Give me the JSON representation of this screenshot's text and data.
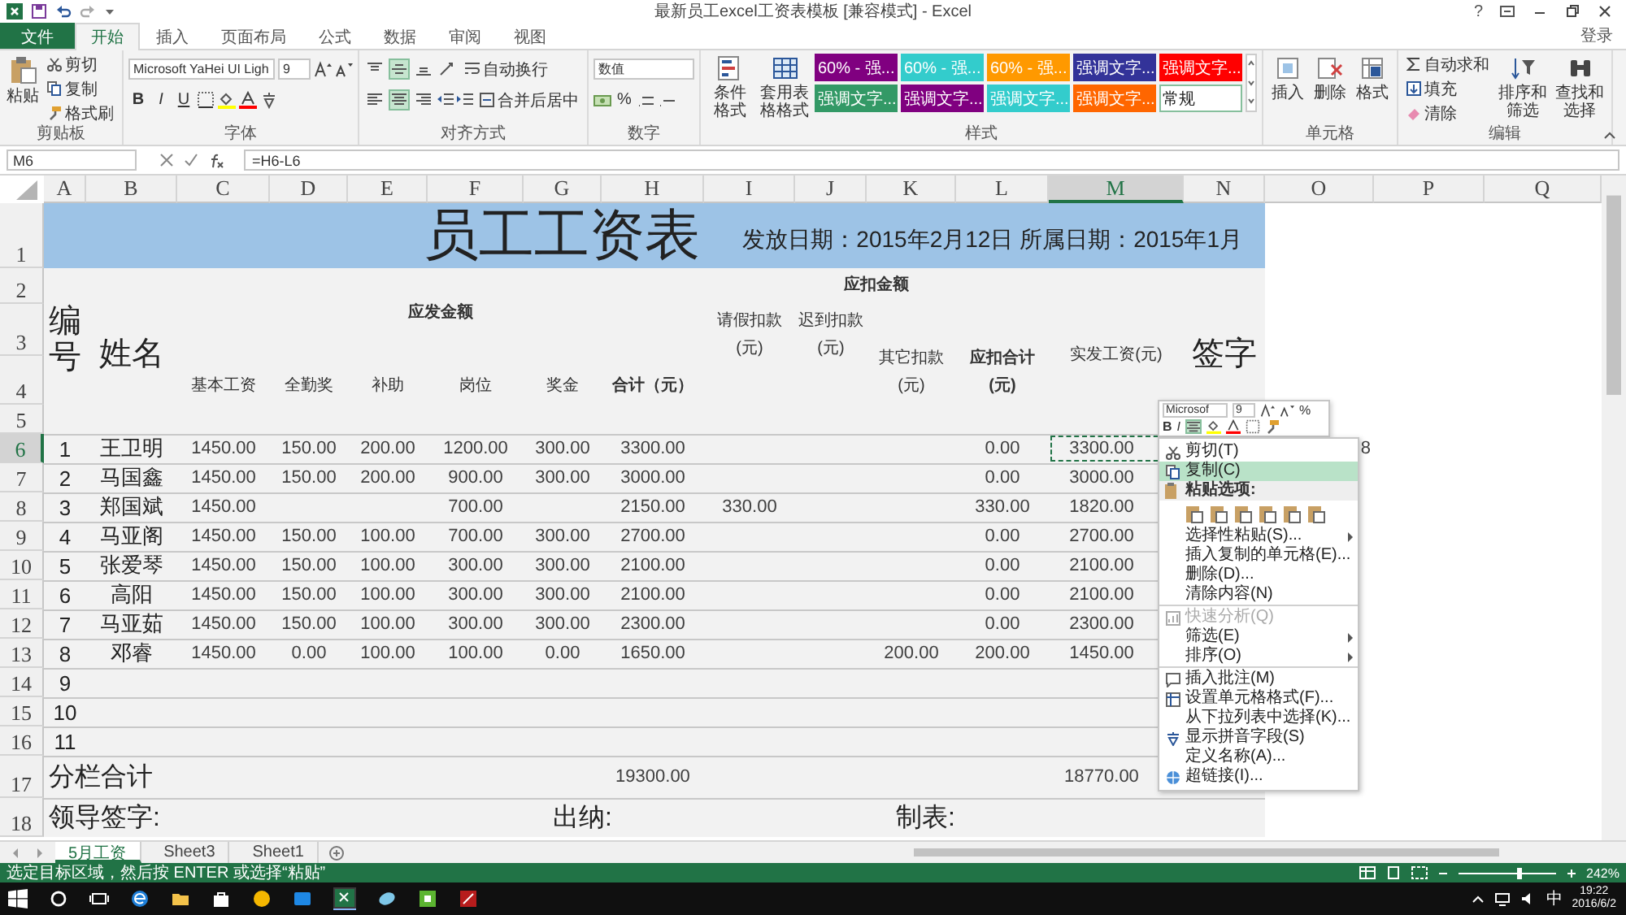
{
  "window": {
    "title": "最新员工excel工资表模板 [兼容模式] - Excel",
    "help": "?"
  },
  "ribbon_tabs": [
    {
      "label": "文件",
      "kind": "file",
      "selected": false
    },
    {
      "label": "开始",
      "kind": "tab",
      "selected": true
    },
    {
      "label": "插入",
      "kind": "tab",
      "selected": false
    },
    {
      "label": "页面布局",
      "kind": "tab",
      "selected": false
    },
    {
      "label": "公式",
      "kind": "tab",
      "selected": false
    },
    {
      "label": "数据",
      "kind": "tab",
      "selected": false
    },
    {
      "label": "审阅",
      "kind": "tab",
      "selected": false
    },
    {
      "label": "视图",
      "kind": "tab",
      "selected": false
    }
  ],
  "sign_in": "登录",
  "ribbon": {
    "clipboard": {
      "label": "剪贴板",
      "paste": "粘贴",
      "cut": "剪切",
      "copy": "复制",
      "format_painter": "格式刷"
    },
    "font": {
      "label": "字体",
      "font_name": "Microsoft YaHei UI Ligh",
      "font_size": "9",
      "bold": "B",
      "italic": "I",
      "underline": "U"
    },
    "alignment": {
      "label": "对齐方式",
      "wrap_text": "自动换行",
      "merge_center": "合并后居中",
      "vertical": [
        {
          "selected": false
        },
        {
          "selected": true
        },
        {
          "selected": false
        }
      ],
      "horizontal": [
        {
          "selected": false
        },
        {
          "selected": true
        },
        {
          "selected": false
        }
      ]
    },
    "number": {
      "label": "数字",
      "format": "数值",
      "percent": "%"
    },
    "styles": {
      "label": "样式",
      "conditional_formatting": "条件格式",
      "format_as_table": "套用表格格式",
      "gallery": [
        {
          "label": "60% - 强...",
          "color": "#800080",
          "selected": false
        },
        {
          "label": "60% - 强...",
          "color": "#33cccc",
          "selected": false
        },
        {
          "label": "60% - 强...",
          "color": "#ff9900",
          "selected": false
        },
        {
          "label": "强调文字...",
          "color": "#333399",
          "selected": false
        },
        {
          "label": "强调文字...",
          "color": "#ff0000",
          "selected": false
        },
        {
          "label": "强调文字...",
          "color": "#339966",
          "selected": false
        },
        {
          "label": "强调文字...",
          "color": "#800080",
          "selected": false
        },
        {
          "label": "强调文字...",
          "color": "#33cccc",
          "selected": false
        },
        {
          "label": "强调文字...",
          "color": "#ff6600",
          "selected": false
        },
        {
          "label": "常规",
          "color": "#ffffff",
          "selected": true
        }
      ]
    },
    "cells": {
      "label": "单元格",
      "insert": "插入",
      "delete": "删除",
      "format": "格式"
    },
    "editing": {
      "label": "编辑",
      "autosum": "自动求和",
      "fill": "填充",
      "clear": "清除",
      "sort_filter": "排序和筛选",
      "find_select": "查找和选择"
    }
  },
  "formula_bar": {
    "name_box": "M6",
    "formula": "=H6-L6"
  },
  "columns": [
    {
      "label": "A",
      "selected": false
    },
    {
      "label": "B",
      "selected": false
    },
    {
      "label": "C",
      "selected": false
    },
    {
      "label": "D",
      "selected": false
    },
    {
      "label": "E",
      "selected": false
    },
    {
      "label": "F",
      "selected": false
    },
    {
      "label": "G",
      "selected": false
    },
    {
      "label": "H",
      "selected": false
    },
    {
      "label": "I",
      "selected": false
    },
    {
      "label": "J",
      "selected": false
    },
    {
      "label": "K",
      "selected": false
    },
    {
      "label": "L",
      "selected": false
    },
    {
      "label": "M",
      "selected": true
    },
    {
      "label": "N",
      "selected": false
    },
    {
      "label": "O",
      "selected": false
    },
    {
      "label": "P",
      "selected": false
    },
    {
      "label": "Q",
      "selected": false
    }
  ],
  "row_headers": [
    {
      "label": "1",
      "selected": false
    },
    {
      "label": "2",
      "selected": false
    },
    {
      "label": "3",
      "selected": false
    },
    {
      "label": "4",
      "selected": false
    },
    {
      "label": "5",
      "selected": false
    },
    {
      "label": "6",
      "selected": true
    },
    {
      "label": "7",
      "selected": false
    },
    {
      "label": "8",
      "selected": false
    },
    {
      "label": "9",
      "selected": false
    },
    {
      "label": "10",
      "selected": false
    },
    {
      "label": "11",
      "selected": false
    },
    {
      "label": "12",
      "selected": false
    },
    {
      "label": "13",
      "selected": false
    },
    {
      "label": "14",
      "selected": false
    },
    {
      "label": "15",
      "selected": false
    },
    {
      "label": "16",
      "selected": false
    },
    {
      "label": "17",
      "selected": false
    },
    {
      "label": "18",
      "selected": false
    }
  ],
  "sheet": {
    "title": "员工工资表",
    "dates": "发放日期：2015年2月12日 所属日期：2015年1月",
    "headers": {
      "no": "编号",
      "name": "姓名",
      "payable": "应发金额",
      "deductions": "应扣金额",
      "leave": "请假扣款(元)",
      "late": "迟到扣款(元)",
      "other": "其它扣款(元)",
      "deduct_total": "应扣合计(元)",
      "net": "实发工资(元)",
      "signature": "签字",
      "base": "基本工资",
      "attendance": "全勤奖",
      "allowance": "补助",
      "post": "岗位",
      "bonus": "奖金",
      "gross": "合计（元）"
    },
    "rows": [
      {
        "no": "1",
        "name": "王卫明",
        "base": "1450.00",
        "attendance": "150.00",
        "allowance": "200.00",
        "post": "1200.00",
        "bonus": "300.00",
        "gross": "3300.00",
        "deduct_total": "0.00",
        "net": "3300.00"
      },
      {
        "no": "2",
        "name": "马国鑫",
        "base": "1450.00",
        "attendance": "150.00",
        "allowance": "200.00",
        "post": "900.00",
        "bonus": "300.00",
        "gross": "3000.00",
        "deduct_total": "0.00",
        "net": "3000.00"
      },
      {
        "no": "3",
        "name": "郑国斌",
        "base": "1450.00",
        "post": "700.00",
        "gross": "2150.00",
        "leave": "330.00",
        "deduct_total": "330.00",
        "net": "1820.00"
      },
      {
        "no": "4",
        "name": "马亚阁",
        "base": "1450.00",
        "attendance": "150.00",
        "allowance": "100.00",
        "post": "700.00",
        "bonus": "300.00",
        "gross": "2700.00",
        "deduct_total": "0.00",
        "net": "2700.00"
      },
      {
        "no": "5",
        "name": "张爱琴",
        "base": "1450.00",
        "attendance": "150.00",
        "allowance": "100.00",
        "post": "300.00",
        "bonus": "300.00",
        "gross": "2100.00",
        "deduct_total": "0.00",
        "net": "2100.00"
      },
      {
        "no": "6",
        "name": "高阳",
        "base": "1450.00",
        "attendance": "150.00",
        "allowance": "100.00",
        "post": "300.00",
        "bonus": "300.00",
        "gross": "2100.00",
        "deduct_total": "0.00",
        "net": "2100.00"
      },
      {
        "no": "7",
        "name": "马亚茹",
        "base": "1450.00",
        "attendance": "150.00",
        "allowance": "100.00",
        "post": "300.00",
        "bonus": "300.00",
        "gross": "2300.00",
        "deduct_total": "0.00",
        "net": "2300.00"
      },
      {
        "no": "8",
        "name": "邓睿",
        "base": "1450.00",
        "attendance": "0.00",
        "allowance": "100.00",
        "post": "100.00",
        "bonus": "0.00",
        "gross": "1650.00",
        "other": "200.00",
        "deduct_total": "200.00",
        "net": "1450.00"
      },
      {
        "no": "9"
      },
      {
        "no": "10"
      },
      {
        "no": "11"
      }
    ],
    "stray_value": "8",
    "totals": {
      "label": "分栏合计",
      "gross": "19300.00",
      "net": "18770.00"
    },
    "footer": [
      "领导签字:",
      "出纳:",
      "制表:"
    ]
  },
  "context_menu": {
    "mini_toolbar": {
      "font_name": "Microsof",
      "font_size": "9",
      "bold": "B",
      "italic": "I",
      "percent": "%",
      "center_selected": true
    },
    "items": [
      {
        "label": "剪切(T)",
        "kind": "command",
        "selected": false,
        "disabled": false,
        "submenu": false,
        "group_start": false
      },
      {
        "label": "复制(C)",
        "kind": "command",
        "selected": true,
        "disabled": false,
        "submenu": false,
        "group_start": false
      },
      {
        "label": "粘贴选项:",
        "kind": "header"
      },
      {
        "kind": "paste_options"
      },
      {
        "label": "选择性粘贴(S)...",
        "kind": "command",
        "selected": false,
        "disabled": false,
        "submenu": true,
        "group_start": false
      },
      {
        "label": "插入复制的单元格(E)...",
        "kind": "command",
        "selected": false,
        "disabled": false,
        "submenu": false,
        "group_start": false
      },
      {
        "label": "删除(D)...",
        "kind": "command",
        "selected": false,
        "disabled": false,
        "submenu": false,
        "group_start": false
      },
      {
        "label": "清除内容(N)",
        "kind": "command",
        "selected": false,
        "disabled": false,
        "submenu": false,
        "group_start": false
      },
      {
        "label": "快速分析(Q)",
        "kind": "command",
        "selected": false,
        "disabled": true,
        "submenu": false,
        "group_start": true
      },
      {
        "label": "筛选(E)",
        "kind": "command",
        "selected": false,
        "disabled": false,
        "submenu": true,
        "group_start": false
      },
      {
        "label": "排序(O)",
        "kind": "command",
        "selected": false,
        "disabled": false,
        "submenu": true,
        "group_start": false
      },
      {
        "label": "插入批注(M)",
        "kind": "command",
        "selected": false,
        "disabled": false,
        "submenu": false,
        "group_start": true
      },
      {
        "label": "设置单元格格式(F)...",
        "kind": "command",
        "selected": false,
        "disabled": false,
        "submenu": false,
        "group_start": false
      },
      {
        "label": "从下拉列表中选择(K)...",
        "kind": "command",
        "selected": false,
        "disabled": false,
        "submenu": false,
        "group_start": false
      },
      {
        "label": "显示拼音字段(S)",
        "kind": "command",
        "selected": false,
        "disabled": false,
        "submenu": false,
        "group_start": false
      },
      {
        "label": "定义名称(A)...",
        "kind": "command",
        "selected": false,
        "disabled": false,
        "submenu": false,
        "group_start": false
      },
      {
        "label": "超链接(I)...",
        "kind": "command",
        "selected": false,
        "disabled": false,
        "submenu": false,
        "group_start": false
      }
    ]
  },
  "sheet_tabs": [
    {
      "label": "5月工资",
      "selected": true
    },
    {
      "label": "Sheet3",
      "selected": false
    },
    {
      "label": "Sheet1",
      "selected": false
    }
  ],
  "status_bar": {
    "message": "选定目标区域，然后按 ENTER 或选择“粘贴”",
    "zoom": "242%",
    "zoom_slider": {
      "level": 0.62
    }
  },
  "taskbar": {
    "ime": "中",
    "time": "19:22",
    "date": "2016/6/2"
  }
}
